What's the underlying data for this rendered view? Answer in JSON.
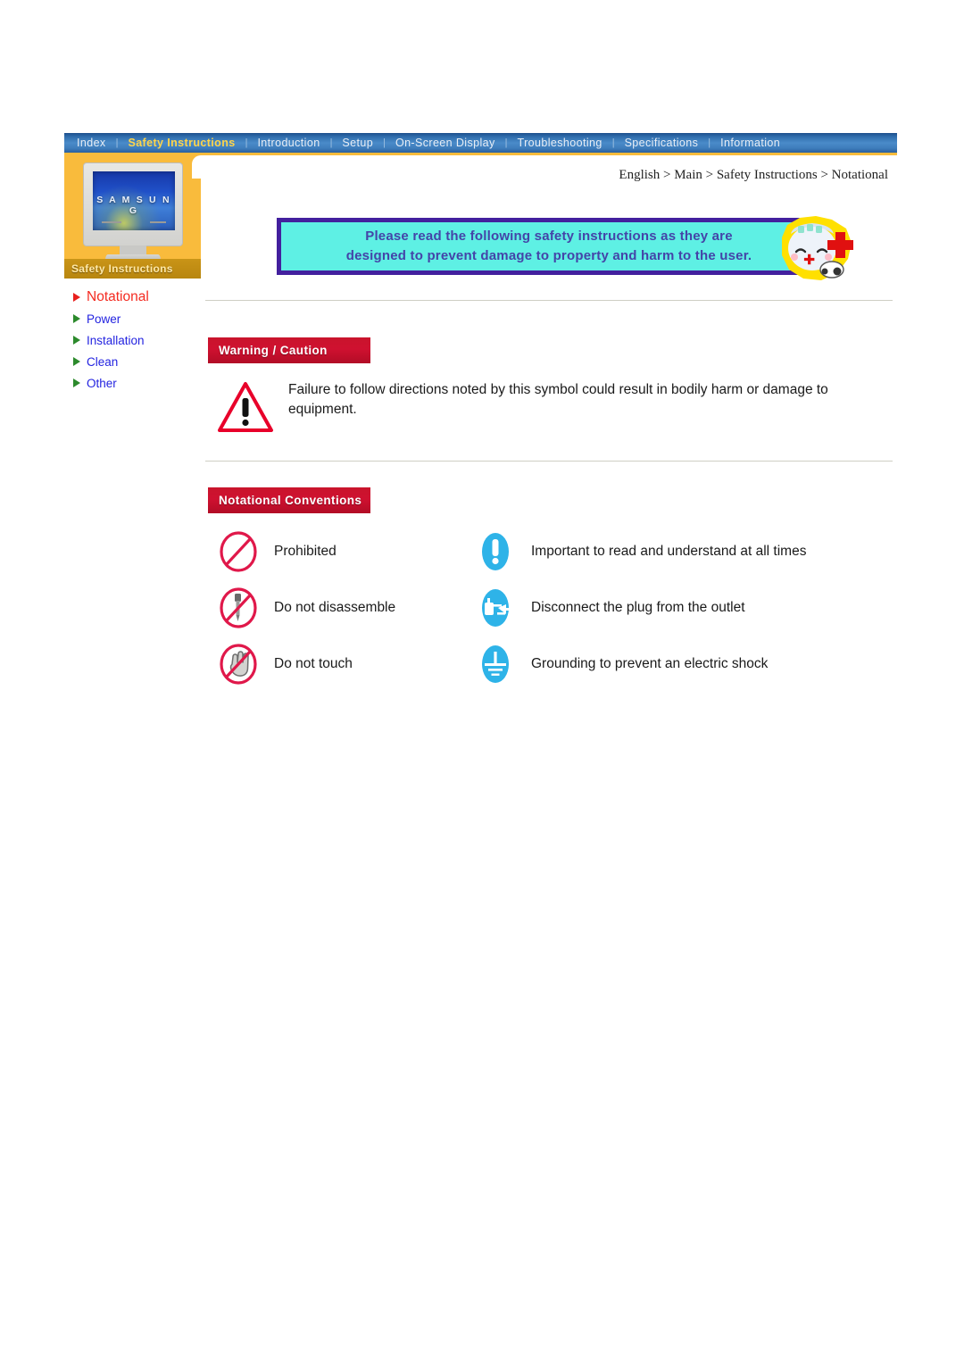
{
  "nav": {
    "separator": "|",
    "items": [
      {
        "label": "Index",
        "active": false
      },
      {
        "label": "Safety Instructions",
        "active": true
      },
      {
        "label": "Introduction",
        "active": false
      },
      {
        "label": "Setup",
        "active": false
      },
      {
        "label": "On-Screen Display",
        "active": false
      },
      {
        "label": "Troubleshooting",
        "active": false
      },
      {
        "label": "Specifications",
        "active": false
      },
      {
        "label": "Information",
        "active": false
      }
    ]
  },
  "sidebar": {
    "thumbnail_logo": "S A M S U N G",
    "caption": "Safety Instructions",
    "items": [
      {
        "label": "Notational",
        "current": true
      },
      {
        "label": "Power",
        "current": false
      },
      {
        "label": "Installation",
        "current": false
      },
      {
        "label": "Clean",
        "current": false
      },
      {
        "label": "Other",
        "current": false
      }
    ]
  },
  "breadcrumb": "English > Main > Safety Instructions > Notational",
  "hero": {
    "line1": "Please read the following safety instructions as they are",
    "line2": "designed to prevent damage to property and harm to the user."
  },
  "warning": {
    "header": "Warning / Caution",
    "body": "Failure to follow directions noted by this symbol could result in bodily harm or damage to equipment."
  },
  "notational": {
    "header": "Notational Conventions",
    "rows": [
      {
        "left": {
          "icon": "prohibited-icon",
          "label": "Prohibited"
        },
        "right": {
          "icon": "important-icon",
          "label": "Important to read and understand at all times"
        }
      },
      {
        "left": {
          "icon": "no-disassemble-icon",
          "label": "Do not disassemble"
        },
        "right": {
          "icon": "unplug-icon",
          "label": "Disconnect the plug from the outlet"
        }
      },
      {
        "left": {
          "icon": "no-touch-icon",
          "label": "Do not touch"
        },
        "right": {
          "icon": "grounding-icon",
          "label": "Grounding to prevent an electric shock"
        }
      }
    ]
  },
  "colors": {
    "nav_blue": "#2f6cab",
    "accent_orange": "#f9bb3c",
    "header_red": "#c9142c",
    "link_blue": "#2323e0",
    "current_red": "#f42a20",
    "hero_cyan": "#5ef0e4",
    "hero_purple": "#43209e",
    "icon_cyan": "#2eb3e8"
  }
}
